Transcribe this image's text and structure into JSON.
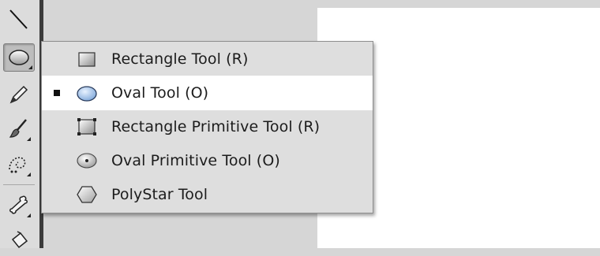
{
  "tools_menu": {
    "items": [
      {
        "label": "Rectangle Tool (R)",
        "icon": "rectangle-icon",
        "active": false
      },
      {
        "label": "Oval Tool (O)",
        "icon": "oval-icon",
        "active": true
      },
      {
        "label": "Rectangle Primitive Tool (R)",
        "icon": "rectangle-primitive-icon",
        "active": false
      },
      {
        "label": "Oval Primitive Tool (O)",
        "icon": "oval-primitive-icon",
        "active": false
      },
      {
        "label": "PolyStar Tool",
        "icon": "polystar-icon",
        "active": false
      }
    ]
  },
  "toolbar": {
    "tools": [
      "line-tool-icon",
      "oval-tool-icon",
      "pencil-icon",
      "brush-icon",
      "deco-icon",
      "bone-icon",
      "paint-bucket-icon"
    ],
    "selected": "oval-tool-icon"
  },
  "colors": {
    "menu_background": "#dedede",
    "menu_active": "#ffffff",
    "toolbar_edge": "#3b3b3b",
    "stage": "#ffffff",
    "oval_fill": "#9fc0e6"
  }
}
